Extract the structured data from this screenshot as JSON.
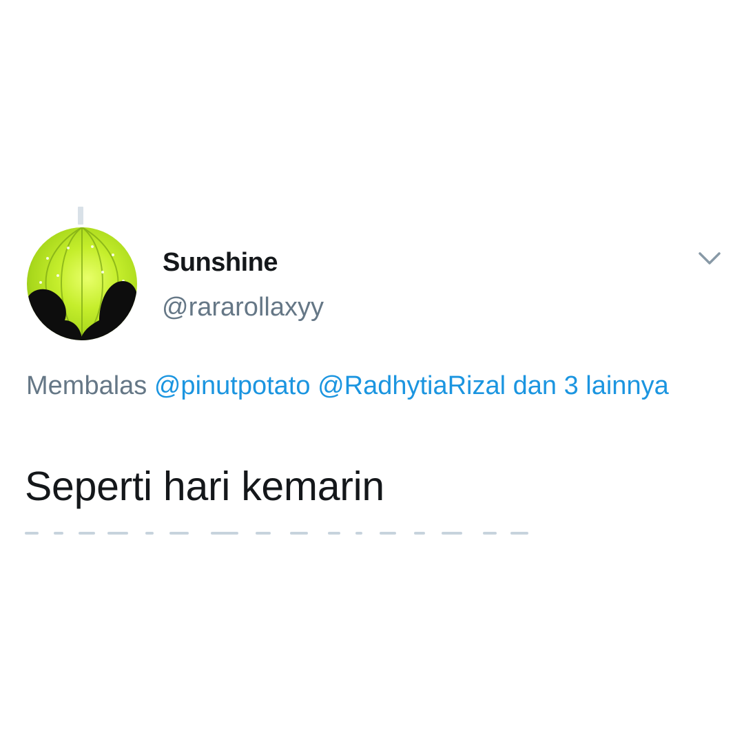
{
  "tweet": {
    "display_name": "Sunshine",
    "handle": "@rararollaxyy",
    "reply_prefix": "Membalas",
    "reply_mentions": [
      "@pinutpotato",
      "@RadhytiaRizal"
    ],
    "reply_suffix": "dan 3 lainnya",
    "text": "Seperti hari kemarin"
  },
  "icons": {
    "menu": "chevron-down-icon",
    "avatar": "profile-photo-lantern"
  },
  "colors": {
    "name": "#14171a",
    "secondary": "#657786",
    "link": "#1b95e0",
    "avatar_green": "#c5ee2c"
  }
}
